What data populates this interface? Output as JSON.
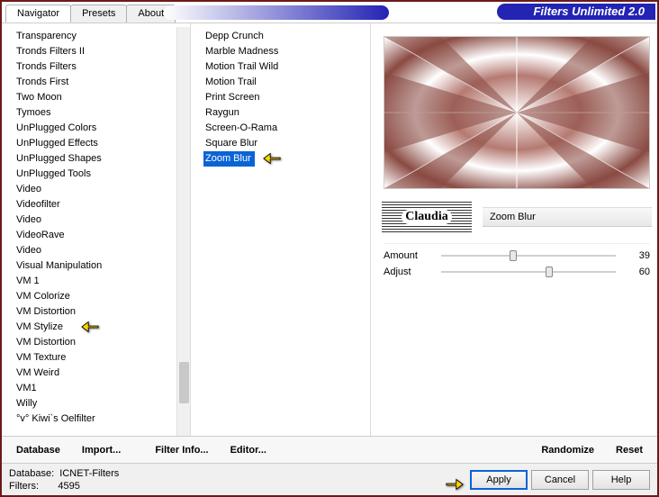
{
  "app": {
    "title": "Filters Unlimited 2.0"
  },
  "tabs": {
    "items": [
      {
        "label": "Navigator",
        "active": true
      },
      {
        "label": "Presets",
        "active": false
      },
      {
        "label": "About",
        "active": false
      }
    ]
  },
  "left_list": {
    "items": [
      "Transparency",
      "Tronds Filters II",
      "Tronds Filters",
      "Tronds First",
      "Two Moon",
      "Tymoes",
      "UnPlugged Colors",
      "UnPlugged Effects",
      "UnPlugged Shapes",
      "UnPlugged Tools",
      "Video",
      "Videofilter",
      "Video",
      "VideoRave",
      "Video",
      "Visual Manipulation",
      "VM 1",
      "VM Colorize",
      "VM Distortion",
      "VM Stylize",
      "VM Distortion",
      "VM Texture",
      "VM Weird",
      "VM1",
      "Willy",
      "°v° Kiwi`s Oelfilter"
    ],
    "highlighted_index": 19,
    "scroll_thumb_top_pct": 82,
    "scroll_thumb_height_pct": 10
  },
  "mid_list": {
    "items": [
      "Depp Crunch",
      "Marble Madness",
      "Motion Trail Wild",
      "Motion Trail",
      "Print Screen",
      "Raygun",
      "Screen-O-Rama",
      "Square Blur",
      "Zoom Blur"
    ],
    "selected_index": 8
  },
  "preview": {
    "color": "#8a4a42"
  },
  "logo": {
    "text": "Claudia"
  },
  "filter": {
    "name": "Zoom Blur",
    "params": [
      {
        "label": "Amount",
        "value": 39,
        "max": 100
      },
      {
        "label": "Adjust",
        "value": 60,
        "max": 100
      }
    ]
  },
  "footer": {
    "database": "Database",
    "import": "Import...",
    "filter_info": "Filter Info...",
    "editor": "Editor...",
    "randomize": "Randomize",
    "reset": "Reset"
  },
  "status": {
    "db_label": "Database:",
    "db_name": "ICNET-Filters",
    "filters_label": "Filters:",
    "filters_count": "4595"
  },
  "buttons": {
    "apply": "Apply",
    "cancel": "Cancel",
    "help": "Help"
  }
}
